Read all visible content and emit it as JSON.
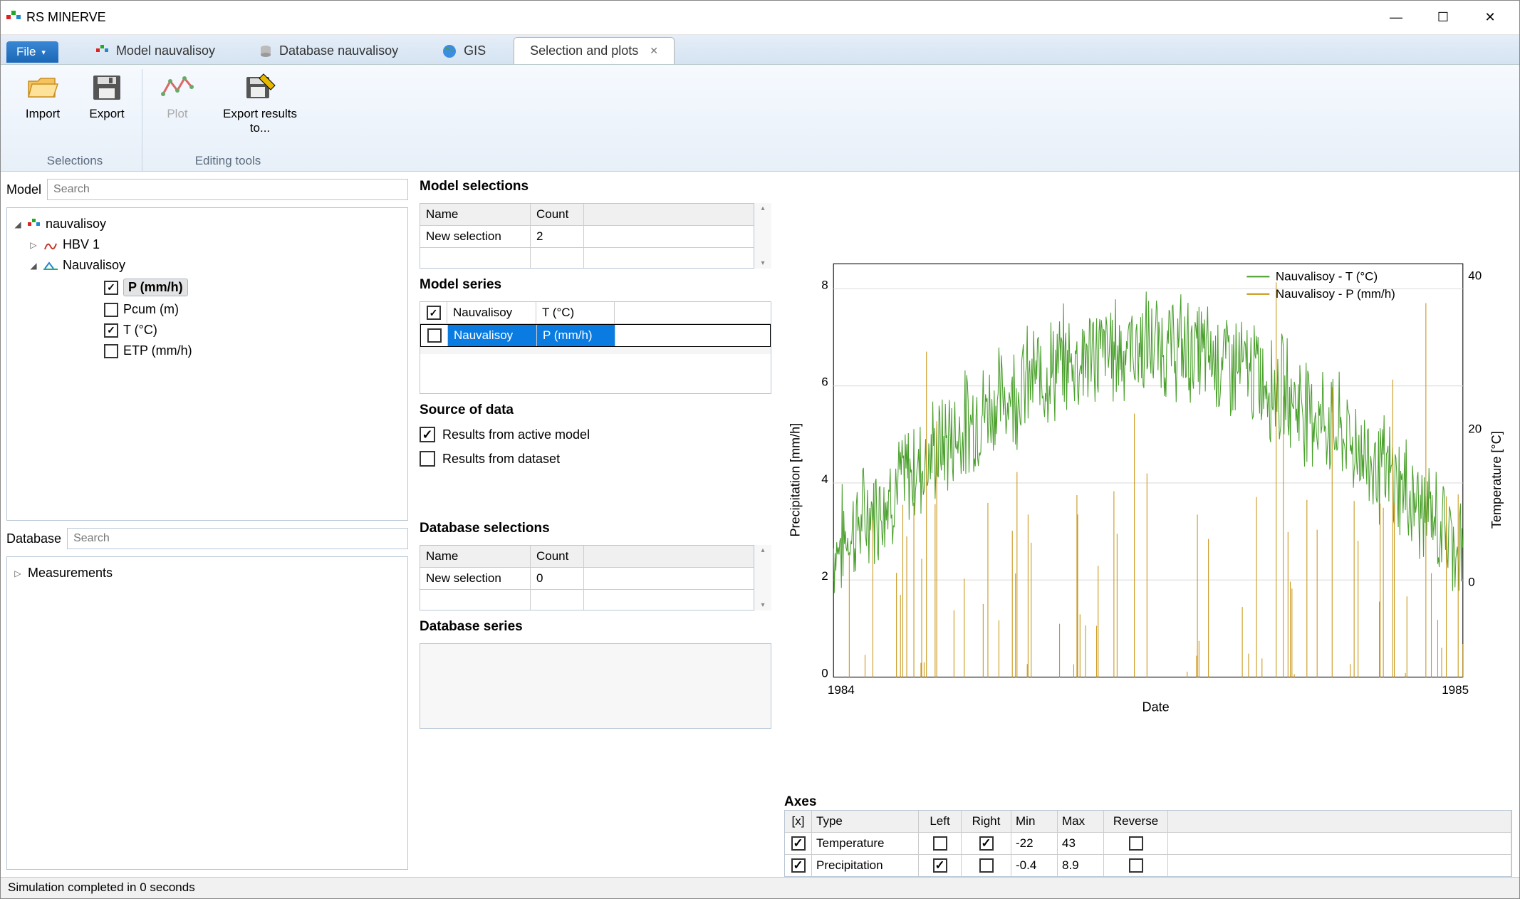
{
  "title": "RS MINERVE",
  "file_menu": "File",
  "tabs": [
    {
      "label": "Model nauvalisoy",
      "icon": "model-icon"
    },
    {
      "label": "Database nauvalisoy",
      "icon": "database-icon"
    },
    {
      "label": "GIS",
      "icon": "globe-icon"
    },
    {
      "label": "Selection and plots",
      "icon": "plots-icon",
      "active": true,
      "closable": true
    }
  ],
  "ribbon": {
    "selections": {
      "title": "Selections",
      "import": "Import",
      "export": "Export"
    },
    "editing": {
      "title": "Editing tools",
      "plot": "Plot",
      "export_results": "Export results to..."
    }
  },
  "model_panel": {
    "label": "Model",
    "search_placeholder": "Search",
    "tree": {
      "root": "nauvalisoy",
      "hbv": "HBV 1",
      "station": "Nauvalisoy",
      "vars": [
        {
          "label": "P (mm/h)",
          "checked": true,
          "selected": true
        },
        {
          "label": "Pcum (m)",
          "checked": false
        },
        {
          "label": "T (°C)",
          "checked": true
        },
        {
          "label": "ETP (mm/h)",
          "checked": false
        }
      ]
    }
  },
  "database_panel": {
    "label": "Database",
    "search_placeholder": "Search",
    "root": "Measurements"
  },
  "model_selections": {
    "title": "Model selections",
    "headers": {
      "name": "Name",
      "count": "Count"
    },
    "rows": [
      {
        "name": "New selection",
        "count": "2"
      }
    ]
  },
  "model_series": {
    "title": "Model series",
    "rows": [
      {
        "checked": true,
        "station": "Nauvalisoy",
        "var": "T (°C)"
      },
      {
        "checked": true,
        "station": "Nauvalisoy",
        "var": "P (mm/h)",
        "selected": true
      }
    ]
  },
  "source_of_data": {
    "title": "Source of data",
    "active_model": {
      "label": "Results from active model",
      "checked": true
    },
    "dataset": {
      "label": "Results from dataset",
      "checked": false
    }
  },
  "database_selections": {
    "title": "Database selections",
    "headers": {
      "name": "Name",
      "count": "Count"
    },
    "rows": [
      {
        "name": "New selection",
        "count": "0"
      }
    ]
  },
  "database_series_title": "Database series",
  "axes_section": {
    "title": "Axes",
    "headers": {
      "x": "[x]",
      "type": "Type",
      "left": "Left",
      "right": "Right",
      "min": "Min",
      "max": "Max",
      "rev": "Reverse"
    },
    "rows": [
      {
        "on": true,
        "type": "Temperature",
        "left": false,
        "right": true,
        "min": "-22",
        "max": "43",
        "rev": false
      },
      {
        "on": true,
        "type": "Precipitation",
        "left": true,
        "right": false,
        "min": "-0.4",
        "max": "8.9",
        "rev": false
      }
    ]
  },
  "chart": {
    "y1_label": "Precipitation [mm/h]",
    "y2_label": "Temperature [°C]",
    "x_label": "Date",
    "legend_t": "Nauvalisoy - T (°C)",
    "legend_p": "Nauvalisoy - P (mm/h)",
    "y1_ticks": [
      "0",
      "2",
      "4",
      "6",
      "8"
    ],
    "y2_ticks": [
      "0",
      "20",
      "40"
    ],
    "x_ticks": [
      "1984",
      "1985"
    ]
  },
  "chart_data": {
    "type": "line",
    "title": "",
    "xlabel": "Date",
    "x_range": [
      "1984",
      "1985"
    ],
    "series": [
      {
        "name": "Nauvalisoy - T (°C)",
        "axis": "right",
        "ylabel": "Temperature [°C]",
        "ylim": [
          -22,
          43
        ],
        "min_approx": 0,
        "max_approx": 30,
        "color": "#4aa02c"
      },
      {
        "name": "Nauvalisoy - P (mm/h)",
        "axis": "left",
        "ylabel": "Precipitation [mm/h]",
        "ylim": [
          -0.4,
          8.9
        ],
        "min_approx": 0,
        "max_approx": 8,
        "color": "#c99618"
      }
    ],
    "note": "Very dense hourly time-series over one year; individual point values not readable from image, only axis ranges and general shape (temperature bell curve peaking mid-year ~30°C, precipitation mostly 0–2 mm/h with spikes up to ~8)."
  },
  "status": "Simulation completed in 0 seconds"
}
